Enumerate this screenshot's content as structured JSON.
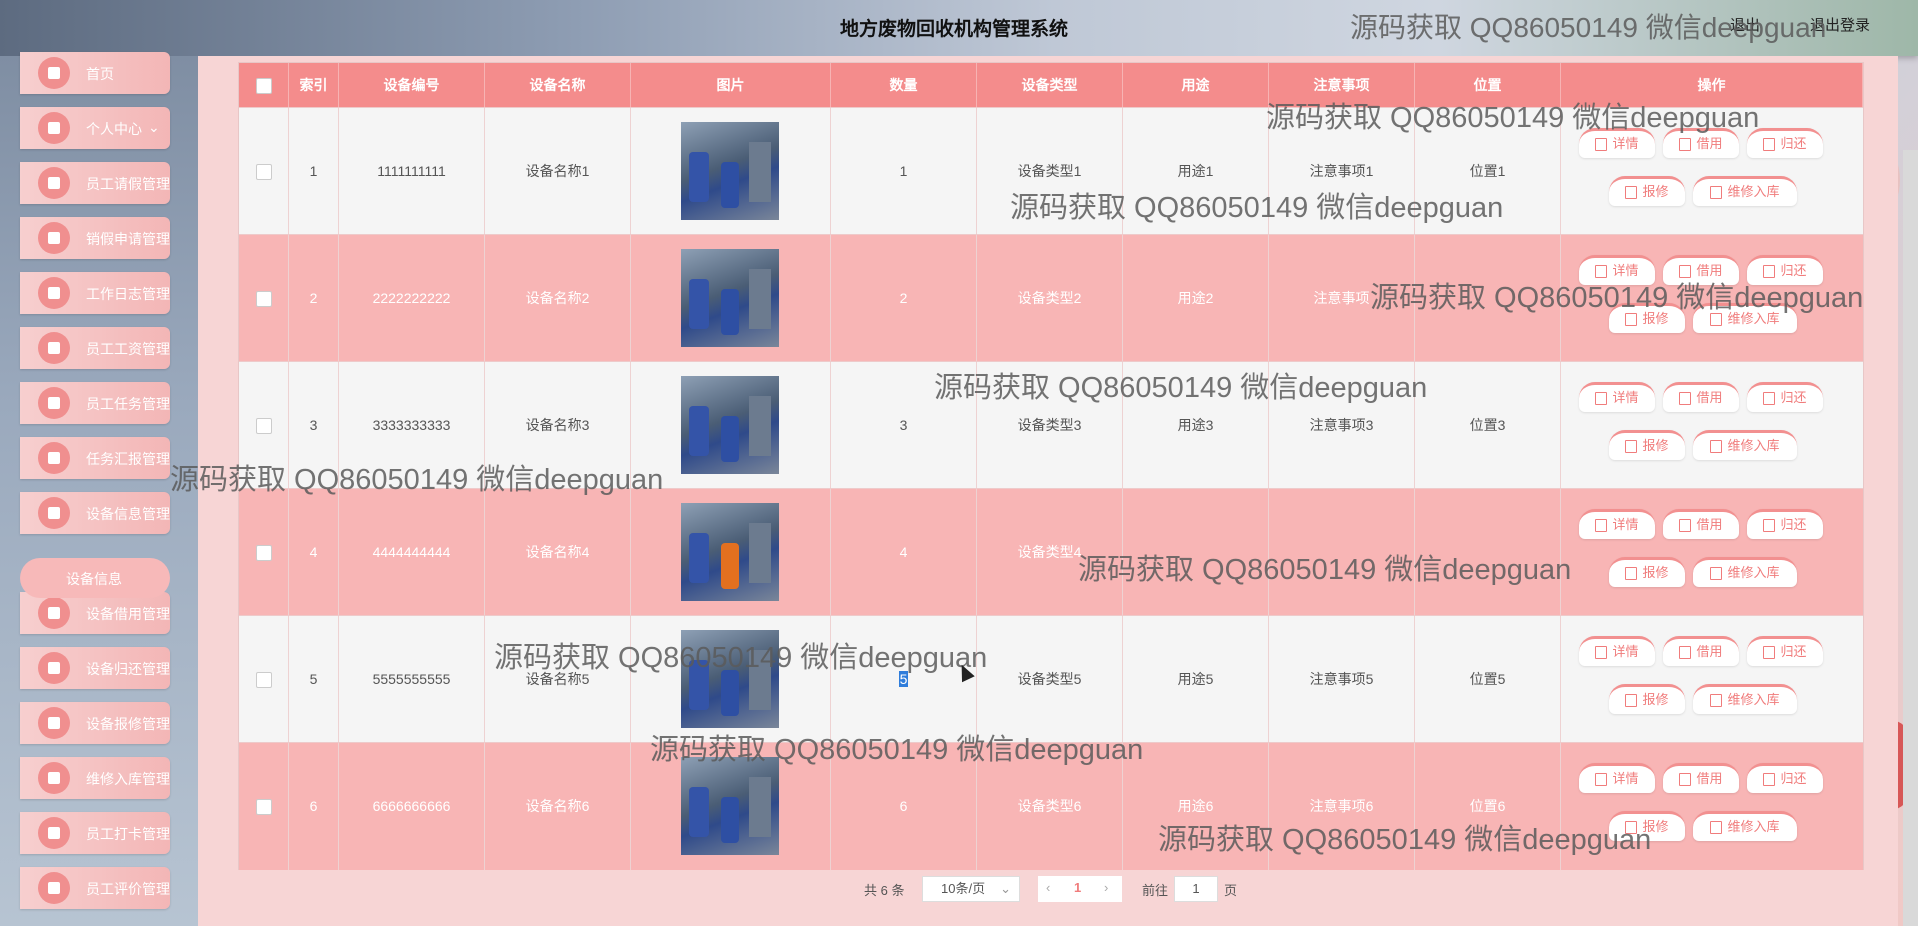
{
  "header": {
    "title": "地方废物回收机构管理系统",
    "top_right": [
      "退出",
      "退出登录"
    ]
  },
  "sidebar": {
    "items": [
      {
        "label": "首页",
        "icon": "home-icon"
      },
      {
        "label": "个人中心",
        "icon": "user-icon",
        "has_chevron": true
      },
      {
        "label": "员工请假管理",
        "icon": "clipboard-icon"
      },
      {
        "label": "销假申请管理",
        "icon": "grid-icon"
      },
      {
        "label": "工作日志管理",
        "icon": "monitor-icon"
      },
      {
        "label": "员工工资管理",
        "icon": "user-icon"
      },
      {
        "label": "员工任务管理",
        "icon": "grid-icon"
      },
      {
        "label": "任务汇报管理",
        "icon": "grid-icon"
      },
      {
        "label": "设备信息管理",
        "icon": "grid-icon"
      },
      {
        "label": "设备借用管理",
        "icon": "clipboard-icon"
      },
      {
        "label": "设备归还管理",
        "icon": "grid-icon"
      },
      {
        "label": "设备报修管理",
        "icon": "grid-icon"
      },
      {
        "label": "维修入库管理",
        "icon": "pass-icon"
      },
      {
        "label": "员工打卡管理",
        "icon": "grid-icon"
      },
      {
        "label": "员工评价管理",
        "icon": "clipboard-icon"
      }
    ],
    "sub_item": "设备信息"
  },
  "table": {
    "columns": [
      "",
      "索引",
      "设备编号",
      "设备名称",
      "图片",
      "数量",
      "设备类型",
      "用途",
      "注意事项",
      "位置",
      "操作"
    ],
    "rows": [
      {
        "index": "1",
        "code": "1111111111",
        "name": "设备名称1",
        "qty": "1",
        "type": "设备类型1",
        "use": "用途1",
        "note": "注意事项1",
        "loc": "位置1"
      },
      {
        "index": "2",
        "code": "2222222222",
        "name": "设备名称2",
        "qty": "2",
        "type": "设备类型2",
        "use": "用途2",
        "note": "注意事项",
        "loc": ""
      },
      {
        "index": "3",
        "code": "3333333333",
        "name": "设备名称3",
        "qty": "3",
        "type": "设备类型3",
        "use": "用途3",
        "note": "注意事项3",
        "loc": "位置3"
      },
      {
        "index": "4",
        "code": "4444444444",
        "name": "设备名称4",
        "qty": "4",
        "type": "设备类型4",
        "use": "",
        "note": "",
        "loc": ""
      },
      {
        "index": "5",
        "code": "5555555555",
        "name": "设备名称5",
        "qty": "5",
        "type": "设备类型5",
        "use": "用途5",
        "note": "注意事项5",
        "loc": "位置5"
      },
      {
        "index": "6",
        "code": "6666666666",
        "name": "设备名称6",
        "qty": "6",
        "type": "设备类型6",
        "use": "用途6",
        "note": "注意事项6",
        "loc": "位置6"
      }
    ],
    "actions": {
      "detail": "详情",
      "borrow": "借用",
      "return": "归还",
      "repair": "报修",
      "store": "维修入库"
    }
  },
  "pagination": {
    "total": "共 6 条",
    "page_size": "10条/页",
    "current_page": "1",
    "goto_label": "前往",
    "goto_value": "1",
    "page_unit": "页"
  },
  "watermark": "源码获取 QQ86050149 微信deepguan",
  "colors": {
    "accent": "#f48c8c",
    "row_even": "#f8b5b5",
    "row_odd": "#f5f5f5"
  }
}
